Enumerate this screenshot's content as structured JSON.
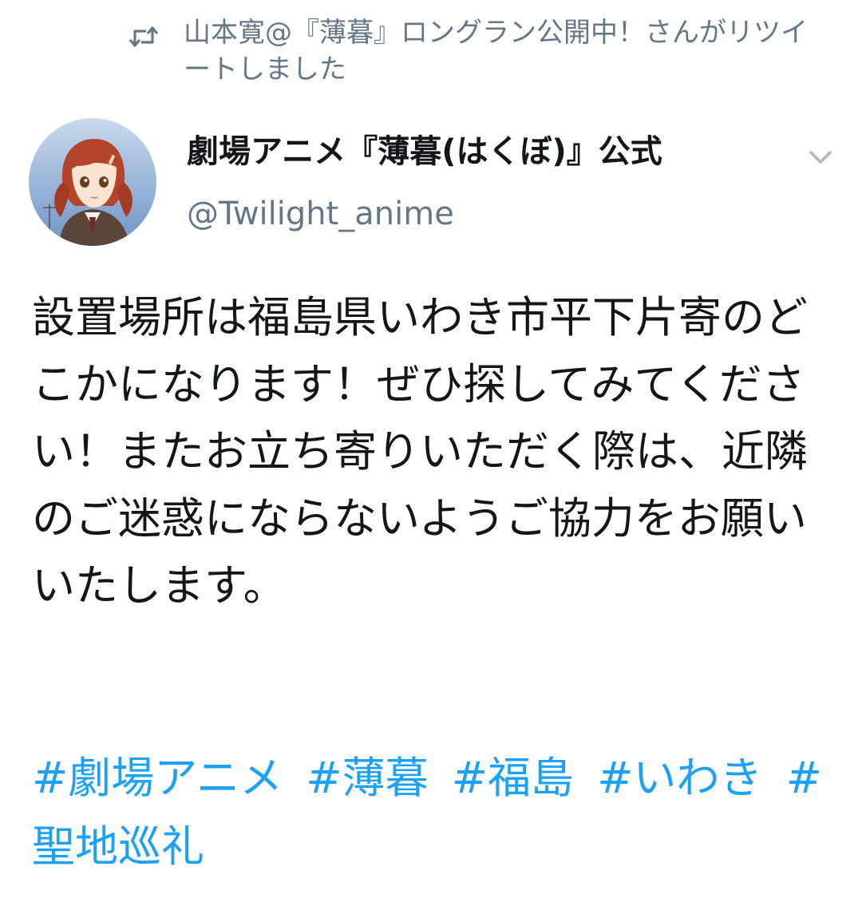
{
  "retweet": {
    "icon": "retweet-icon",
    "text": "山本寛@『薄暮』ロングラン公開中！さんがリツイートしました"
  },
  "author": {
    "display_name": "劇場アニメ『薄暮(はくぼ)』公式",
    "username": "@Twilight_anime",
    "avatar": "avatar-image"
  },
  "menu": {
    "icon": "chevron-down-icon"
  },
  "tweet": {
    "text": "設置場所は福島県いわき市平下片寄のどこかになります！ぜひ探してみてください！またお立ち寄りいただく際は、近隣のご迷惑にならないようご協力をお願いいたします。",
    "hashtags": [
      "#劇場アニメ",
      "#薄暮",
      "#福島",
      "#いわき",
      "#聖地巡礼"
    ]
  },
  "colors": {
    "link": "#1da1f2",
    "secondary_text": "#657786",
    "primary_text": "#14171a"
  }
}
